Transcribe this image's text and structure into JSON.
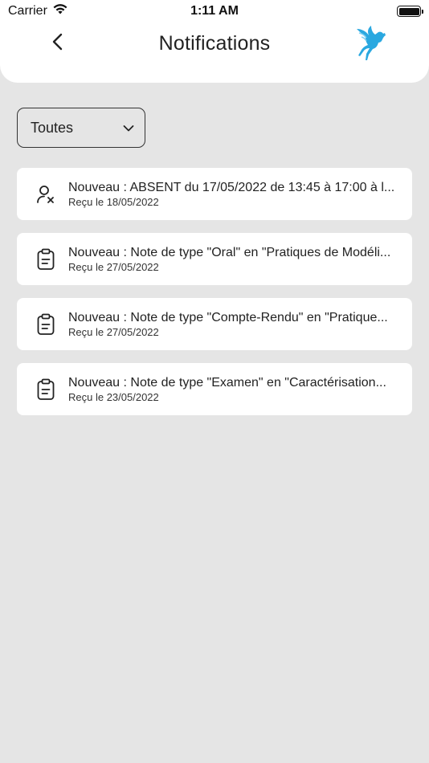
{
  "status_bar": {
    "carrier": "Carrier",
    "time": "1:11 AM",
    "icons": [
      "wifi-icon",
      "battery-icon"
    ]
  },
  "header": {
    "title": "Notifications",
    "back_icon": "chevron-left-icon",
    "logo": "pegasus-logo"
  },
  "filter": {
    "selected": "Toutes",
    "icon": "chevron-down-icon"
  },
  "notifications": [
    {
      "icon": "user-x-icon",
      "title": "Nouveau : ABSENT du 17/05/2022 de 13:45 à 17:00 à l...",
      "date": "Reçu le 18/05/2022"
    },
    {
      "icon": "clipboard-icon",
      "title": "Nouveau : Note de type \"Oral\" en \"Pratiques de Modéli...",
      "date": "Reçu le 27/05/2022"
    },
    {
      "icon": "clipboard-icon",
      "title": "Nouveau : Note de type \"Compte-Rendu\" en \"Pratique...",
      "date": "Reçu le 27/05/2022"
    },
    {
      "icon": "clipboard-icon",
      "title": "Nouveau : Note de type \"Examen\" en \"Caractérisation...",
      "date": "Reçu le 23/05/2022"
    }
  ],
  "colors": {
    "background": "#e5e5e5",
    "card": "#ffffff",
    "logo_accent": "#2aa8e0"
  }
}
